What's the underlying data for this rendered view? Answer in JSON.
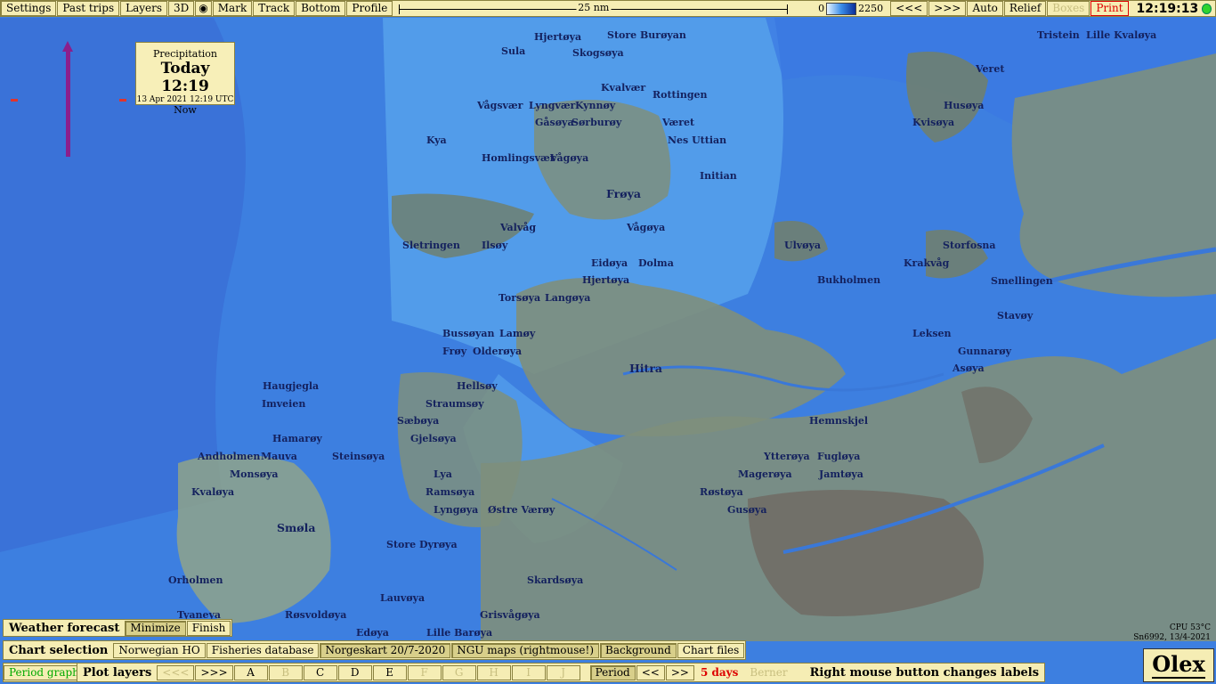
{
  "toolbar": {
    "settings": "Settings",
    "past_trips": "Past trips",
    "layers": "Layers",
    "threed": "3D",
    "mark": "Mark",
    "track": "Track",
    "bottom": "Bottom",
    "profile": "Profile",
    "scale_label": "25 nm",
    "depth_min": "0",
    "depth_max": "2250",
    "back": "<<<",
    "forward": ">>>",
    "auto": "Auto",
    "relief": "Relief",
    "boxes": "Boxes",
    "print": "Print",
    "clock": "12:19:13"
  },
  "overlay": {
    "title": "Precipitation",
    "time": "Today 12:19",
    "date": "13 Apr 2021 12:19 UTC",
    "status": "Now"
  },
  "map_labels": [
    "Store Burøyan",
    "Sula",
    "Hjertøya",
    "Skogsøya",
    "Tristein",
    "Lille Kvaløya",
    "Kvalvær",
    "Rottingen",
    "Vågsvær",
    "Lyngvær",
    "Kynnøy",
    "Veret",
    "Husøya",
    "Gåsøya",
    "Sørburøy",
    "Været",
    "Kya",
    "Nes Uttian",
    "Kvisøya",
    "Homlingsvær",
    "Vågøya",
    "Initian",
    "Frøya",
    "Vågøya",
    "Valvåg",
    "Sletringen",
    "Ilsøy",
    "Storfosna",
    "Krakvåg",
    "Ulvøya",
    "Smellingen",
    "Eidøya",
    "Dolma",
    "Hjertøya",
    "Bukholmen",
    "Torsøya",
    "Langøya",
    "Stavøy",
    "Leksen",
    "Bussøyan",
    "Lamøy",
    "Hitra",
    "Gunnarøy",
    "Asøya",
    "Frøy",
    "Olderøya",
    "Haugjegla",
    "Hellsøy",
    "Imveien",
    "Straumsøy",
    "Hemnskjel",
    "Hamarøy",
    "Sæbøya",
    "Gjelsøya",
    "Andholmen",
    "Mauva",
    "Steinsøya",
    "Ytterøya",
    "Fugløya",
    "Monsøya",
    "Lya",
    "Magerøya",
    "Jamtøya",
    "Kvaløya",
    "Ramsøya",
    "Røstøya",
    "Lyngøya",
    "Østre Værøy",
    "Gusøya",
    "Smøla",
    "Store Dyrøya",
    "Orholmen",
    "Skardsøya",
    "Tyaneya",
    "Lauvøya",
    "Røsvoldøya",
    "Grisvågøya",
    "Edøya",
    "Lille Barøya"
  ],
  "weather_panel": {
    "title": "Weather forecast",
    "minimize": "Minimize",
    "finish": "Finish"
  },
  "chart_panel": {
    "title": "Chart selection",
    "items": [
      {
        "label": "Norwegian HO",
        "pressed": false
      },
      {
        "label": "Fisheries database",
        "pressed": false
      },
      {
        "label": "Norgeskart 20/7-2020",
        "pressed": true
      },
      {
        "label": "NGU maps (rightmouse!)",
        "pressed": true
      },
      {
        "label": "Background",
        "pressed": true
      },
      {
        "label": "Chart files",
        "pressed": false
      }
    ]
  },
  "bottom_bar": {
    "period_graph": "Period graph",
    "plot_layers": "Plot layers",
    "prev": "<<<",
    "next": ">>>",
    "letters": [
      "A",
      "B",
      "C",
      "D",
      "E",
      "F",
      "G",
      "H",
      "I",
      "J"
    ],
    "period": "Period",
    "step_back": "<<",
    "step_fwd": ">>",
    "days": "5 days",
    "berner": "Berner",
    "hint": "Right mouse button changes labels"
  },
  "status": {
    "cpu": "CPU 53°C",
    "build": "Sn6992, 13/4-2021",
    "logo": "Olex"
  },
  "colors": {
    "sea_deep": "#3d7fe0",
    "sea_light": "#5aa6ee",
    "land": "#7e8f7c",
    "panel_bg": "#f5edb4",
    "label_text": "#14215e",
    "north_arrow": "#8b1f8c"
  }
}
